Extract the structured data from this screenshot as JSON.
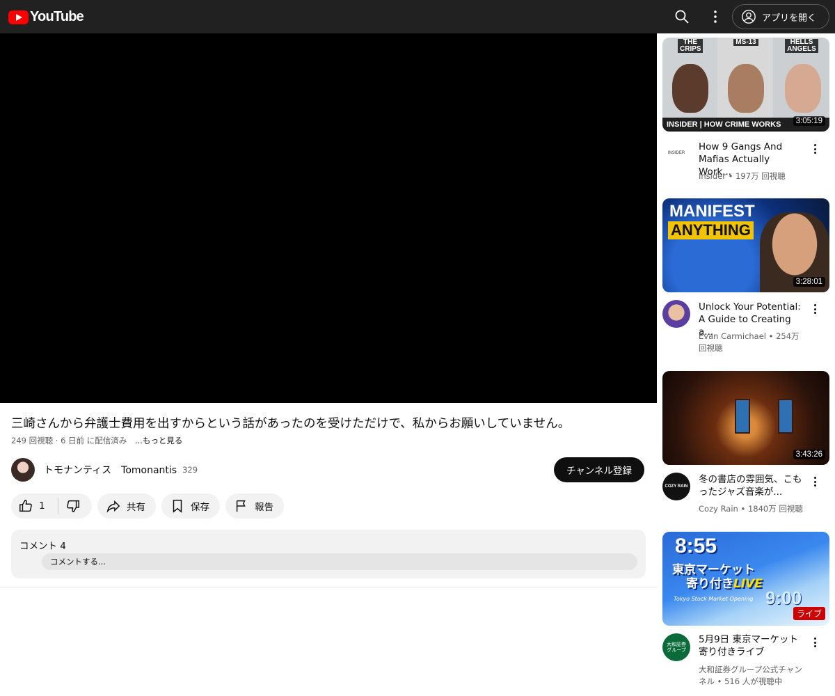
{
  "header": {
    "logo_text": "YouTube",
    "open_app_label": "アプリを開く"
  },
  "video": {
    "title": "三崎さんから弁護士費用を出すからという話があったのを受けただけで、私からお願いしていません。",
    "views": "249 回視聴",
    "date": "6 日前 に配信済み",
    "more_label": "...もっと見る",
    "channel_name": "トモナンティス　Tomonantis",
    "subscriber_count": "329",
    "subscribe_label": "チャンネル登録",
    "likes": "1",
    "share_label": "共有",
    "save_label": "保存",
    "report_label": "報告",
    "comments_header": "コメント 4",
    "comment_placeholder": "コメントする..."
  },
  "recommendations": [
    {
      "title": "How 9 Gangs And Mafias Actually Work...",
      "channel": "Insider",
      "views": "197万 回視聴",
      "duration": "3:05:19",
      "thumb_tags": [
        "THE CRIPS",
        "MS-13",
        "HELLS ANGELS"
      ],
      "thumb_caption": "INSIDER | HOW CRIME WORKS",
      "avatar_text": "INSIDER"
    },
    {
      "title": "Unlock Your Potential: A Guide to Creating a...",
      "channel": "Evan Carmichael",
      "views": "254万 回視聴",
      "duration": "3:28:01",
      "thumb_line1": "MANIFEST",
      "thumb_line2": "ANYTHING"
    },
    {
      "title": "冬の書店の雰囲気、こもったジャズ音楽が...",
      "channel": "Cozy Rain",
      "views": "1840万 回視聴",
      "duration": "3:43:26",
      "avatar_text": "COZY RAIN"
    },
    {
      "title": "5月9日 東京マーケット寄り付きライブ",
      "channel": "大和証券グループ公式チャンネル",
      "views": "516 人が視聴中",
      "live_label": "ライブ",
      "thumb_time": "8:55",
      "thumb_line1": "東京マーケット",
      "thumb_line2": "寄り付き",
      "thumb_live": "LIVE",
      "thumb_time2": "9:00",
      "thumb_small": "Tokyo Stock Market Opening",
      "avatar_text": "大和証券グループ"
    }
  ]
}
